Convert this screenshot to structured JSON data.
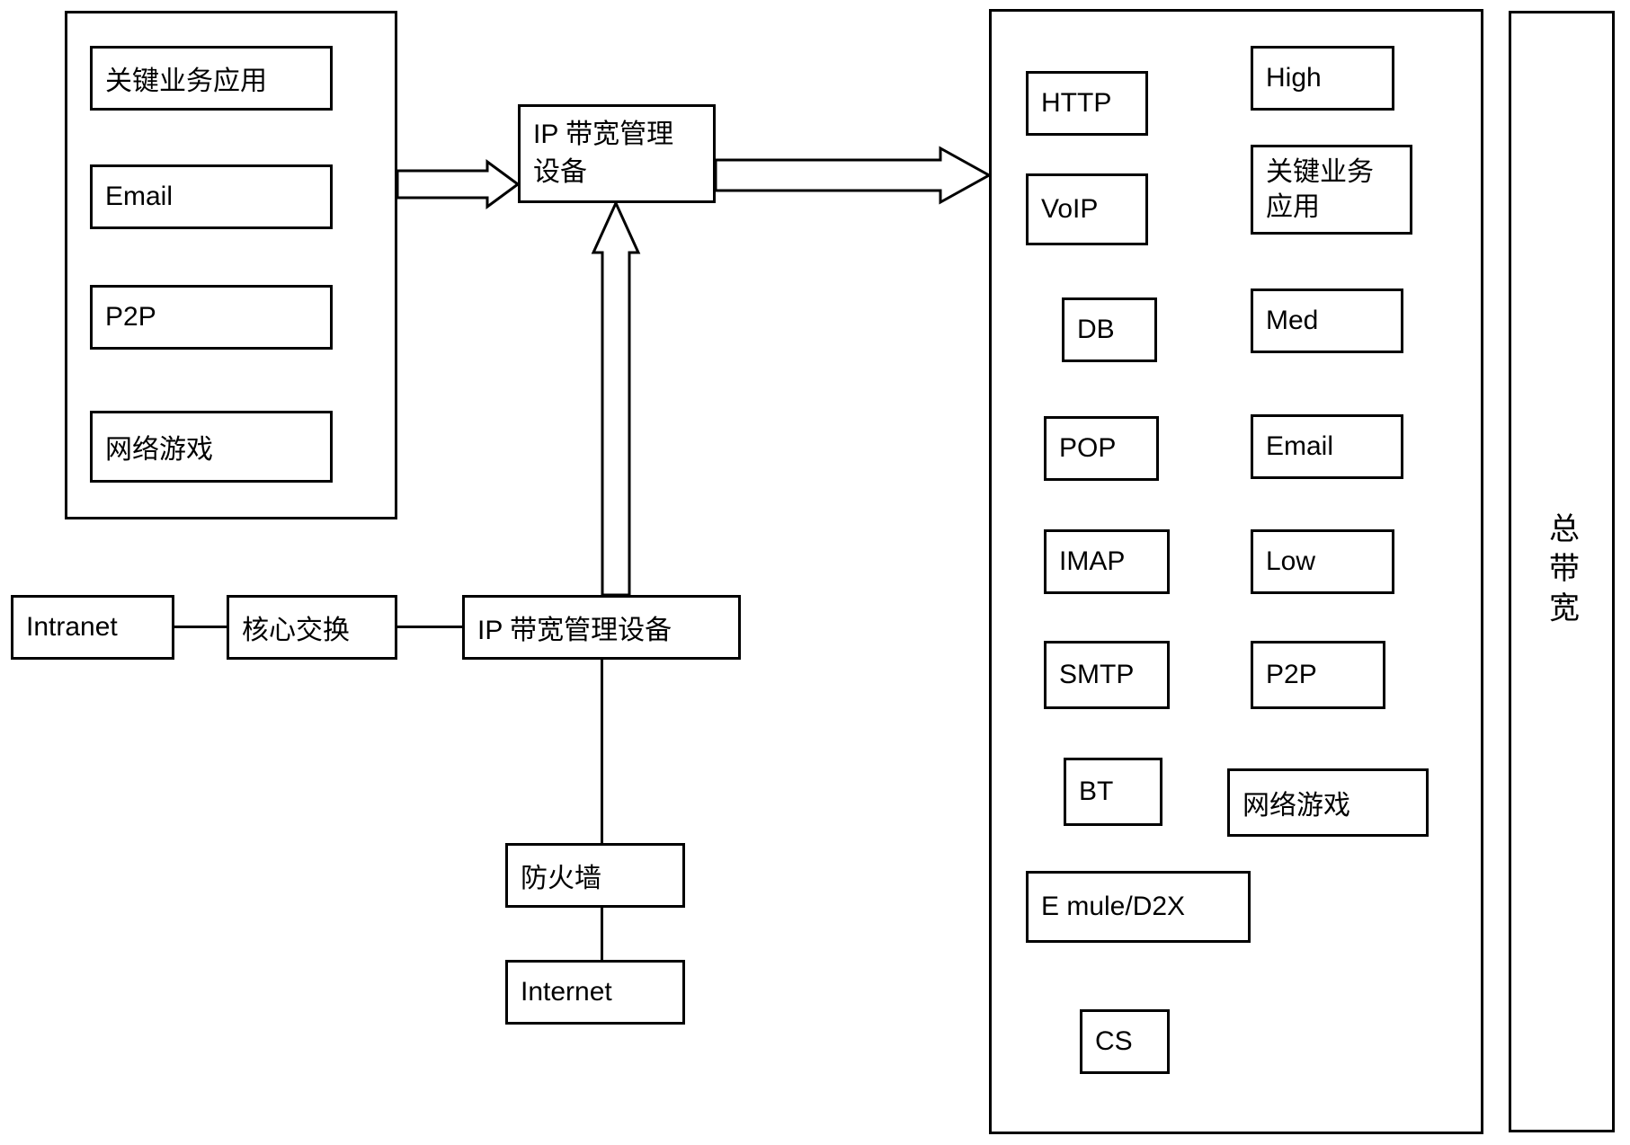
{
  "left_container": {
    "items": [
      {
        "label": "关键业务应用"
      },
      {
        "label": "Email"
      },
      {
        "label": "P2P"
      },
      {
        "label": "网络游戏"
      }
    ]
  },
  "center_top": {
    "label": "IP  带宽管理设备"
  },
  "network_path": {
    "intranet": "Intranet",
    "core_switch": "核心交换",
    "ip_bw_device": "IP 带宽管理设备",
    "firewall": "防火墙",
    "internet": "Internet"
  },
  "right_container": {
    "col1": [
      {
        "label": "HTTP"
      },
      {
        "label": "VoIP"
      },
      {
        "label": "DB"
      },
      {
        "label": "POP"
      },
      {
        "label": "IMAP"
      },
      {
        "label": "SMTP"
      },
      {
        "label": "BT"
      },
      {
        "label": "E mule/D2X"
      },
      {
        "label": "CS"
      }
    ],
    "col2": [
      {
        "label": "High"
      },
      {
        "label": "关键业务应用"
      },
      {
        "label": "Med"
      },
      {
        "label": "Email"
      },
      {
        "label": "Low"
      },
      {
        "label": "P2P"
      },
      {
        "label": "网络游戏"
      }
    ]
  },
  "side_label": "总带宽"
}
